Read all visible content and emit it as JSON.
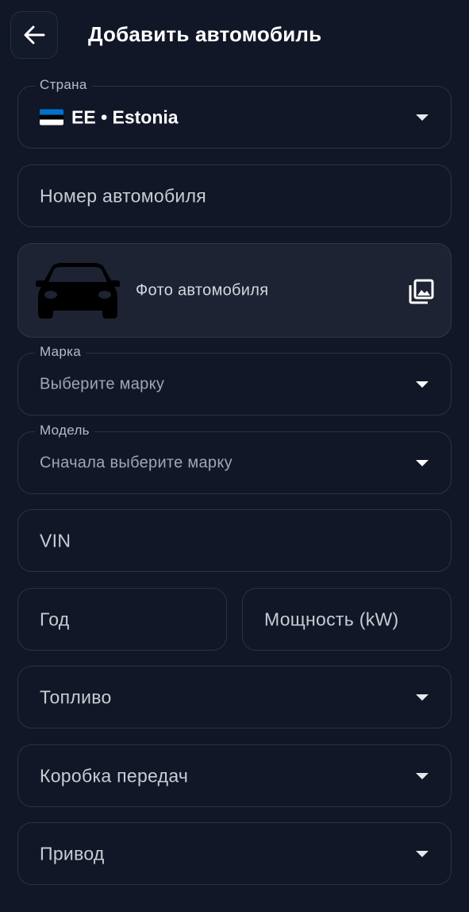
{
  "header": {
    "title": "Добавить автомобиль"
  },
  "country": {
    "label": "Страна",
    "value": "EE • Estonia",
    "flag_colors": [
      "#0072CE",
      "#000000",
      "#FFFFFF"
    ]
  },
  "plate": {
    "placeholder": "Номер автомобиля"
  },
  "photo": {
    "label": "Фото автомобиля"
  },
  "brand": {
    "label": "Марка",
    "value": "Выберите марку"
  },
  "model": {
    "label": "Модель",
    "value": "Сначала выберите марку"
  },
  "vin": {
    "placeholder": "VIN"
  },
  "year": {
    "placeholder": "Год"
  },
  "power": {
    "placeholder": "Мощность (kW)"
  },
  "fuel": {
    "placeholder": "Топливо"
  },
  "gearbox": {
    "placeholder": "Коробка передач"
  },
  "drive": {
    "placeholder": "Привод"
  },
  "icons": {
    "back": "arrow-left-icon",
    "dropdown": "caret-down-icon",
    "car": "car-icon",
    "gallery": "photo-library-icon"
  },
  "colors": {
    "background": "#111726",
    "border": "#2b3244",
    "card": "#1d2333"
  }
}
